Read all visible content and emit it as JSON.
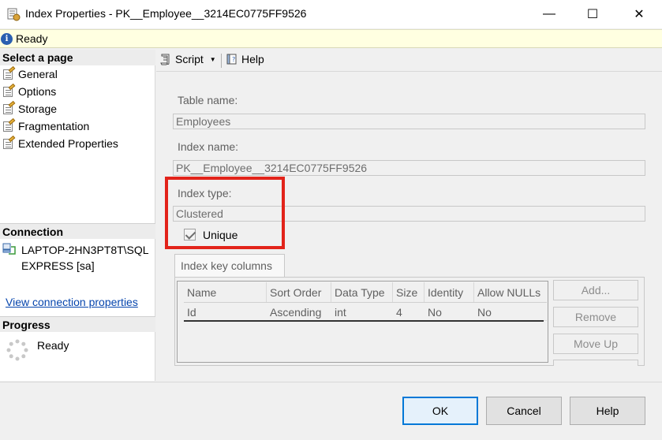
{
  "window": {
    "title": "Index Properties - PK__Employee__3214EC0775FF9526",
    "minimize_glyph": "—",
    "maximize_glyph": "☐",
    "close_glyph": "✕"
  },
  "status": {
    "text": "Ready",
    "icon": "info-icon"
  },
  "left": {
    "select_page_header": "Select a page",
    "pages": [
      {
        "label": "General",
        "icon": "page-settings-icon"
      },
      {
        "label": "Options",
        "icon": "page-settings-icon"
      },
      {
        "label": "Storage",
        "icon": "page-settings-icon"
      },
      {
        "label": "Fragmentation",
        "icon": "page-settings-icon"
      },
      {
        "label": "Extended Properties",
        "icon": "page-settings-icon"
      }
    ],
    "connection_header": "Connection",
    "connection_server_line1": "LAPTOP-2HN3PT8T\\SQL",
    "connection_server_line2": "EXPRESS [sa]",
    "connection_link": "View connection properties",
    "progress_header": "Progress",
    "progress_text": "Ready"
  },
  "toolbar": {
    "script_label": "Script",
    "help_label": "Help"
  },
  "form": {
    "table_name_label": "Table name:",
    "table_name_value": "Employees",
    "index_name_label": "Index name:",
    "index_name_value": "PK__Employee__3214EC0775FF9526",
    "index_type_label": "Index type:",
    "index_type_value": "Clustered",
    "unique_label": "Unique",
    "unique_checked": true,
    "highlight_color": "#e2231a"
  },
  "key_columns": {
    "tab_label": "Index key columns",
    "columns": [
      "Name",
      "Sort Order",
      "Data Type",
      "Size",
      "Identity",
      "Allow NULLs"
    ],
    "rows": [
      [
        "Id",
        "Ascending",
        "int",
        "4",
        "No",
        "No"
      ]
    ],
    "add_button": "Add...",
    "remove_button": "Remove",
    "move_up_button": "Move Up"
  },
  "footer": {
    "ok": "OK",
    "cancel": "Cancel",
    "help": "Help",
    "accent": "#0078d7"
  }
}
